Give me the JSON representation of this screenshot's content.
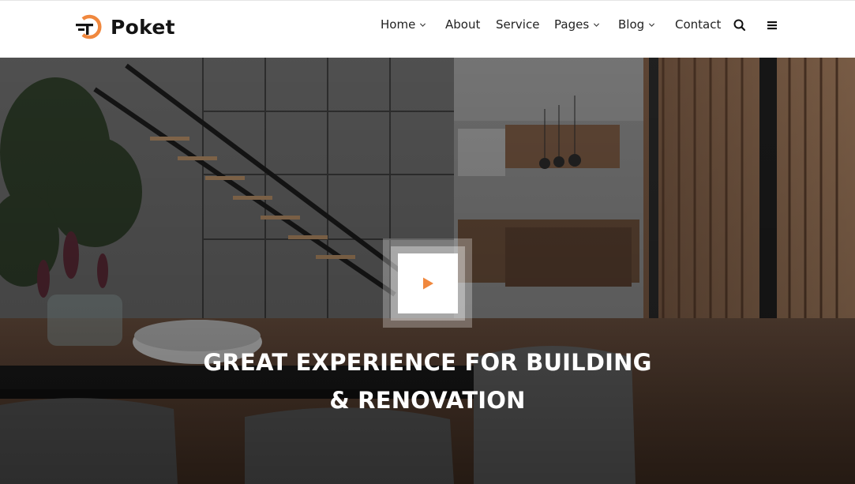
{
  "brand": {
    "name": "Poket",
    "accent": "#f0883e"
  },
  "nav": {
    "items": [
      {
        "label": "Home",
        "dropdown": true
      },
      {
        "label": "About",
        "dropdown": false
      },
      {
        "label": "Service",
        "dropdown": false
      },
      {
        "label": "Pages",
        "dropdown": true
      },
      {
        "label": "Blog",
        "dropdown": true
      },
      {
        "label": "Contact",
        "dropdown": false
      }
    ],
    "icons": [
      "search-icon",
      "menu-icon",
      "chevron-down-icon"
    ]
  },
  "hero": {
    "headline_line1": "GREAT EXPERIENCE FOR BUILDING",
    "headline_line2": "& RENOVATION",
    "play_icon": "play-icon",
    "background": "interior-dining-room-photo"
  }
}
